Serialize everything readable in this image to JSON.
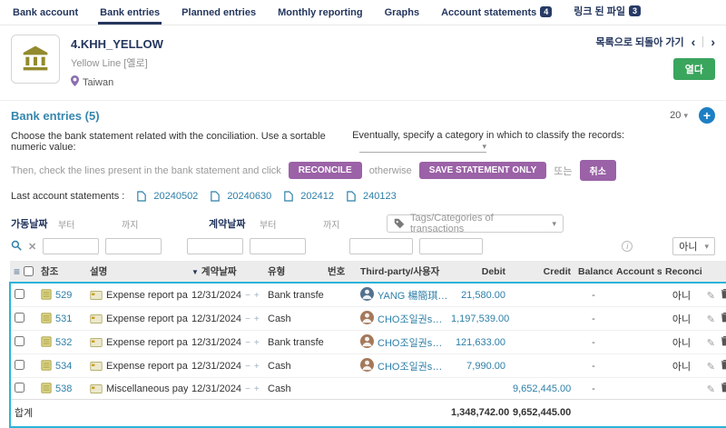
{
  "tabs": {
    "items": [
      {
        "label": "Bank account"
      },
      {
        "label": "Bank entries"
      },
      {
        "label": "Planned entries"
      },
      {
        "label": "Monthly reporting"
      },
      {
        "label": "Graphs"
      },
      {
        "label": "Account statements",
        "badge": "4"
      },
      {
        "label": "링크 된 파일",
        "badge": "3"
      }
    ]
  },
  "header": {
    "title": "4.KHH_YELLOW",
    "subtitle": "Yellow Line [옐로]",
    "location": "Taiwan",
    "back_to_list": "목록으로 되돌아 가기",
    "open_button": "열다"
  },
  "section": {
    "title": "Bank entries (5)",
    "page_size": "20"
  },
  "instructions": {
    "choose_statement": "Choose the bank statement related with the conciliation. Use a sortable numeric value:",
    "specify_category": "Eventually, specify a category in which to classify the records:",
    "check_lines": "Then, check the lines present in the bank statement and click",
    "otherwise": "otherwise",
    "or": "또는"
  },
  "buttons": {
    "reconcile": "RECONCILE",
    "save_statement": "SAVE STATEMENT ONLY",
    "cancel": "취소"
  },
  "statements": {
    "label": "Last account statements :",
    "items": [
      "20240502",
      "20240630",
      "202412",
      "240123"
    ]
  },
  "filters": {
    "operation_date": "가동날짜",
    "contract_date": "계약날짜",
    "from": "부터",
    "to": "까지",
    "tags": "Tags/Categories of transactions",
    "reconciled": "아니"
  },
  "table": {
    "headers": {
      "ref": "참조",
      "description": "설명",
      "date": "계약날짜",
      "type": "유형",
      "number": "번호",
      "third_party": "Third-party/사용자",
      "debit": "Debit",
      "credit": "Credit",
      "balance": "Balance",
      "account_state": "Account state...",
      "reconciled": "Reconciled"
    },
    "rows": [
      {
        "ref": "529",
        "description": "Expense report payment",
        "date": "12/31/2024",
        "type": "Bank transfer",
        "number": "",
        "third_party": "YANG 楊簡琪 RITA",
        "debit": "21,580.00",
        "credit": "",
        "balance": "-",
        "account_state": "",
        "reconciled": "아니"
      },
      {
        "ref": "531",
        "description": "Expense report payment",
        "date": "12/31/2024",
        "type": "Cash",
        "number": "",
        "third_party": "CHO조일권sPM II...",
        "debit": "1,197,539.00",
        "credit": "",
        "balance": "-",
        "account_state": "",
        "reconciled": "아니"
      },
      {
        "ref": "532",
        "description": "Expense report payment",
        "date": "12/31/2024",
        "type": "Bank transfer",
        "number": "",
        "third_party": "CHO조일권sPM II...",
        "debit": "121,633.00",
        "credit": "",
        "balance": "-",
        "account_state": "",
        "reconciled": "아니"
      },
      {
        "ref": "534",
        "description": "Expense report payment",
        "date": "12/31/2024",
        "type": "Cash",
        "number": "",
        "third_party": "CHO조일권sPM II...",
        "debit": "7,990.00",
        "credit": "",
        "balance": "-",
        "account_state": "",
        "reconciled": "아니"
      },
      {
        "ref": "538",
        "description": "Miscellaneous payment",
        "date": "12/31/2024",
        "type": "Cash",
        "number": "",
        "third_party": "",
        "debit": "",
        "credit": "9,652,445.00",
        "balance": "-",
        "account_state": "",
        "reconciled": ""
      }
    ],
    "total_label": "합계",
    "total_debit": "1,348,742.00",
    "total_credit": "9,652,445.00"
  },
  "icons": {
    "sort": "▼",
    "caret": "▾",
    "minus": "−",
    "plus": "+",
    "clear": "✕",
    "pencil": "✎",
    "list": "≡",
    "prev": "‹",
    "next": "›",
    "add": "+"
  }
}
